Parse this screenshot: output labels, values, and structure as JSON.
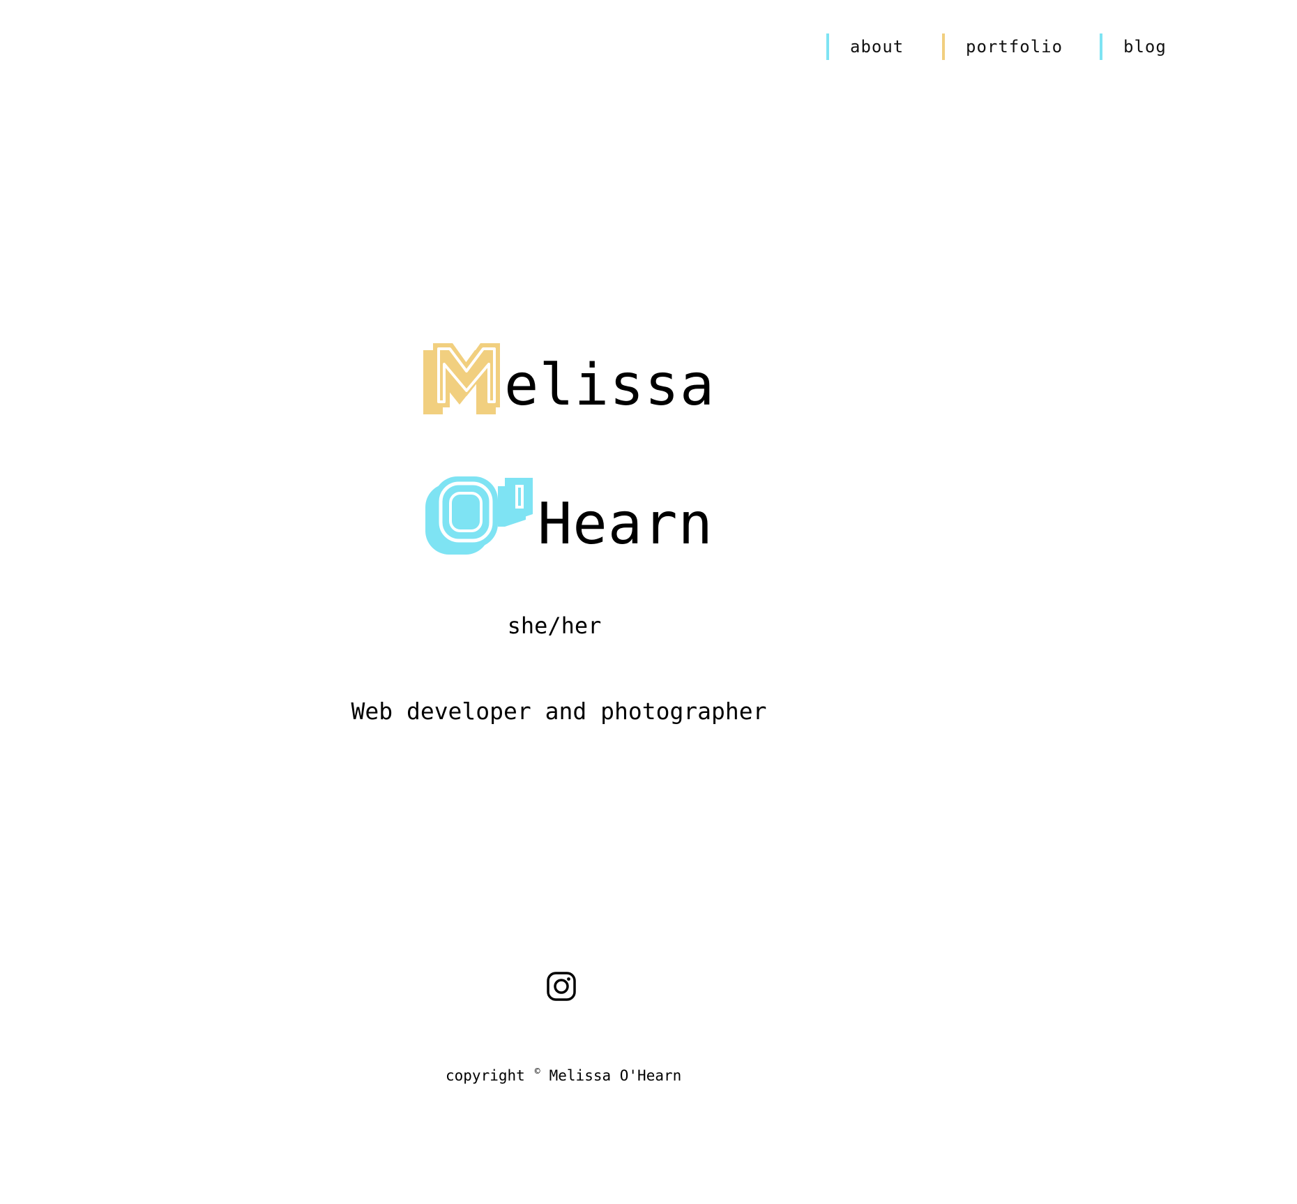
{
  "nav": {
    "items": [
      {
        "label": "about",
        "color": "#7ee3f3"
      },
      {
        "label": "portfolio",
        "color": "#f1cf7f"
      },
      {
        "label": "blog",
        "color": "#7ee3f3"
      }
    ]
  },
  "hero": {
    "first_initial": "M",
    "first_rest": "elissa",
    "last_initial": "O'",
    "last_rest": "Hearn",
    "first_initial_color": "#f1cf7f",
    "last_initial_color": "#7ee3f3"
  },
  "pronouns": "she/her",
  "tagline": "Web developer and photographer",
  "social": {
    "icon": "instagram-icon"
  },
  "footer": {
    "prefix": "copyright",
    "symbol": "©",
    "name": "Melissa O'Hearn"
  }
}
